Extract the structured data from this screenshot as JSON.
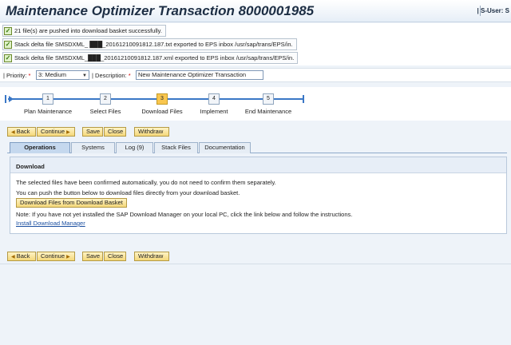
{
  "header": {
    "title": "Maintenance Optimizer Transaction 8000001985",
    "user": "| S-User: S"
  },
  "messages": [
    {
      "icon": "success-check-icon",
      "text": "21 file(s) are pushed into download basket successfully."
    },
    {
      "icon": "success-check-icon",
      "text": "Stack delta file SMSDXML_ ███_20161210091812.187.txt exported to EPS inbox /usr/sap/trans/EPS/in."
    },
    {
      "icon": "success-check-icon",
      "text": "Stack delta file SMSDXML_███_20161210091812.187.xml exported to EPS inbox /usr/sap/trans/EPS/in."
    }
  ],
  "form": {
    "priority_label": "| Priority:",
    "priority_value": "3: Medium",
    "description_label": "| Description:",
    "description_value": "New Maintenance Optimizer Transaction",
    "required_marker": "*"
  },
  "roadmap": {
    "steps": [
      {
        "number": "1",
        "label": "Plan Maintenance"
      },
      {
        "number": "2",
        "label": "Select Files"
      },
      {
        "number": "3",
        "label": "Download Files"
      },
      {
        "number": "4",
        "label": "Implement"
      },
      {
        "number": "5",
        "label": "End Maintenance"
      }
    ],
    "active_step": 3
  },
  "toolbar": {
    "back": "Back",
    "continue": "Continue",
    "save": "Save",
    "close": "Close",
    "withdraw": "Withdraw"
  },
  "tabs": [
    "Operations",
    "Systems",
    "Log (9)",
    "Stack Files",
    "Documentation"
  ],
  "active_tab": "Operations",
  "panel": {
    "title": "Download",
    "line1": "The selected files have been confirmed automatically, you do not need to confirm them separately.",
    "line2": "You can push the button below to download files directly from your download basket.",
    "download_button": "Download Files from Download Basket",
    "line3": "Note: If you have not yet installed the SAP Download Manager on your local PC, click the link below and follow the instructions.",
    "link": "Install Download Manager"
  },
  "colors": {
    "accent_button": "#f5d87a",
    "roadmap_line": "#3a77c6",
    "active_step": "#f9c64e",
    "link": "#1b4fa0"
  }
}
